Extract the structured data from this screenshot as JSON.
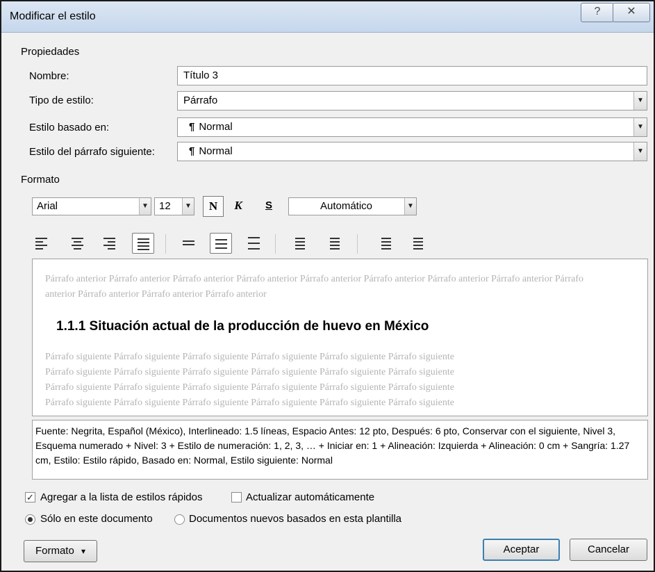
{
  "window": {
    "title": "Modificar el estilo",
    "help_glyph": "?",
    "close_glyph": "✕"
  },
  "properties": {
    "section_label": "Propiedades",
    "name_label": "Nombre:",
    "name_value": "Título 3",
    "type_label": "Tipo de estilo:",
    "type_value": "Párrafo",
    "based_label": "Estilo basado en:",
    "based_value": "Normal",
    "next_label": "Estilo del párrafo siguiente:",
    "next_value": "Normal",
    "paragraph_mark": "¶"
  },
  "format": {
    "section_label": "Formato",
    "font_value": "Arial",
    "size_value": "12",
    "bold_label": "N",
    "italic_label": "K",
    "underline_label": "S",
    "color_value": "Automático",
    "selected_alignment": "justify",
    "selected_spacing": "1.5"
  },
  "preview": {
    "previous_text": "Párrafo anterior Párrafo anterior Párrafo anterior Párrafo anterior Párrafo anterior Párrafo anterior Párrafo anterior Párrafo anterior Párrafo anterior Párrafo anterior Párrafo anterior Párrafo anterior",
    "heading_text": "1.1.1   Situación actual de la producción de huevo en México",
    "next_lines": [
      "Párrafo siguiente Párrafo siguiente Párrafo siguiente Párrafo siguiente Párrafo siguiente Párrafo siguiente",
      "Párrafo siguiente Párrafo siguiente Párrafo siguiente Párrafo siguiente Párrafo siguiente Párrafo siguiente",
      "Párrafo siguiente Párrafo siguiente Párrafo siguiente Párrafo siguiente Párrafo siguiente Párrafo siguiente",
      "Párrafo siguiente Párrafo siguiente Párrafo siguiente Párrafo siguiente Párrafo siguiente Párrafo siguiente"
    ]
  },
  "description": "Fuente: Negrita, Español (México), Interlineado:  1.5 líneas, Espacio Antes:  12 pto, Después:  6 pto, Conservar con el siguiente, Nivel 3, Esquema numerado + Nivel: 3 + Estilo de numeración: 1, 2, 3, … + Iniciar en: 1 + Alineación: Izquierda + Alineación:  0 cm + Sangría:  1.27 cm, Estilo: Estilo rápido, Basado en: Normal, Estilo siguiente: Normal",
  "options": {
    "add_quick_label": "Agregar a la lista de estilos rápidos",
    "add_quick_checked": true,
    "auto_update_label": "Actualizar automáticamente",
    "auto_update_checked": false,
    "only_doc_label": "Sólo en este documento",
    "new_docs_label": "Documentos nuevos basados en esta plantilla",
    "selected_scope": "only_doc"
  },
  "buttons": {
    "format_label": "Formato",
    "format_arrow": "▾",
    "ok_label": "Aceptar",
    "cancel_label": "Cancelar"
  }
}
